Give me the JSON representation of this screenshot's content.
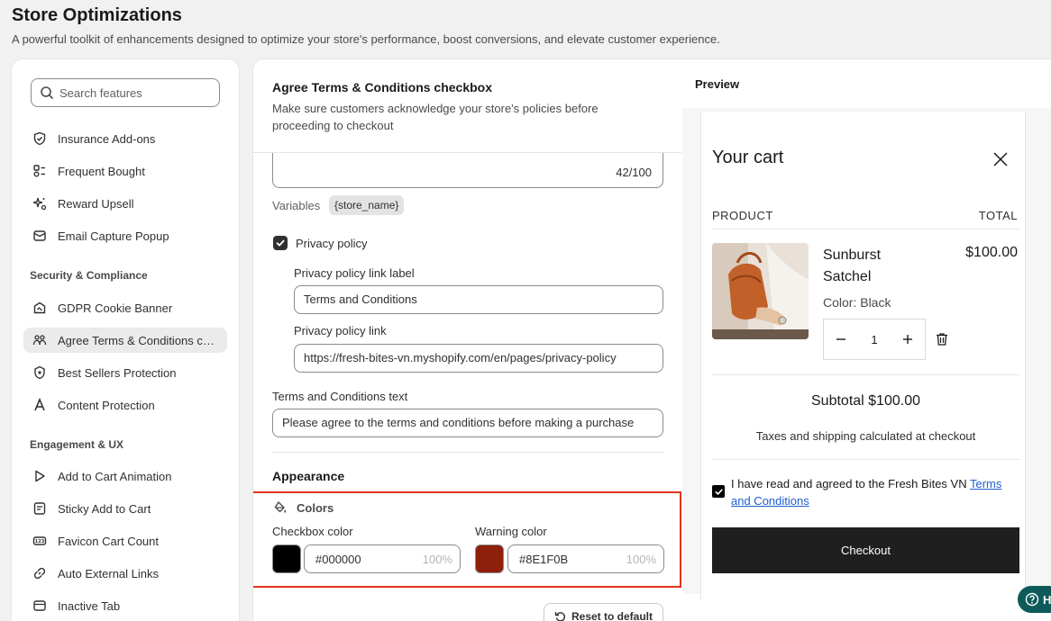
{
  "page": {
    "title": "Store Optimizations",
    "subtitle": "A powerful toolkit of enhancements designed to optimize your store's performance, boost conversions, and elevate customer experience."
  },
  "sidebar": {
    "search_placeholder": "Search features",
    "group1": [
      {
        "label": "Insurance Add-ons",
        "icon": "shield-check-icon"
      },
      {
        "label": "Frequent Bought",
        "icon": "bundle-icon"
      },
      {
        "label": "Reward Upsell",
        "icon": "sparkle-icon"
      },
      {
        "label": "Email Capture Popup",
        "icon": "envelope-icon"
      }
    ],
    "section_security": "Security & Compliance",
    "group2": [
      {
        "label": "GDPR Cookie Banner",
        "icon": "cookie-icon"
      },
      {
        "label": "Agree Terms & Conditions checkbox",
        "icon": "people-icon",
        "active": true
      },
      {
        "label": "Best Sellers Protection",
        "icon": "protection-icon"
      },
      {
        "label": "Content Protection",
        "icon": "letter-a-icon"
      }
    ],
    "section_engagement": "Engagement & UX",
    "group3": [
      {
        "label": "Add to Cart Animation",
        "icon": "play-icon"
      },
      {
        "label": "Sticky Add to Cart",
        "icon": "note-icon"
      },
      {
        "label": "Favicon Cart Count",
        "icon": "counter-icon"
      },
      {
        "label": "Auto External Links",
        "icon": "link-icon"
      },
      {
        "label": "Inactive Tab",
        "icon": "tab-icon"
      }
    ]
  },
  "settings": {
    "title": "Agree Terms & Conditions checkbox",
    "description": "Make sure customers acknowledge your store's policies before proceeding to checkout",
    "char_count": "42/100",
    "variables_label": "Variables",
    "variable_chip": "{store_name}",
    "privacy_checkbox_label": "Privacy policy",
    "privacy_link_label_title": "Privacy policy link label",
    "privacy_link_label_value": "Terms and Conditions",
    "privacy_link_title": "Privacy policy link",
    "privacy_link_value": "https://fresh-bites-vn.myshopify.com/en/pages/privacy-policy",
    "terms_text_title": "Terms and Conditions text",
    "terms_text_value": "Please agree to the terms and conditions before making a purchase",
    "appearance_title": "Appearance",
    "colors_title": "Colors",
    "checkbox_color_label": "Checkbox color",
    "checkbox_color_hex": "#000000",
    "checkbox_color_opacity": "100%",
    "checkbox_color_swatch": "#000000",
    "warning_color_label": "Warning color",
    "warning_color_hex": "#8E1F0B",
    "warning_color_opacity": "100%",
    "warning_color_swatch": "#8E1F0B",
    "reset_label": "Reset to default"
  },
  "preview": {
    "label": "Preview",
    "cart_title": "Your cart",
    "col_product": "PRODUCT",
    "col_total": "TOTAL",
    "product_name": "Sunburst Satchel",
    "product_price": "$100.00",
    "product_variant": "Color: Black",
    "quantity": "1",
    "subtotal": "Subtotal $100.00",
    "tax_note": "Taxes and shipping calculated at checkout",
    "agree_prefix": "I have read and agreed to the Fresh Bites VN ",
    "agree_link": "Terms and Conditions",
    "checkout_label": "Checkout"
  },
  "help": {
    "label": "H"
  },
  "colors": {
    "accent_highlight": "#e3331f",
    "link": "#1f5fce",
    "checkout_bg": "#1f1f1f"
  }
}
